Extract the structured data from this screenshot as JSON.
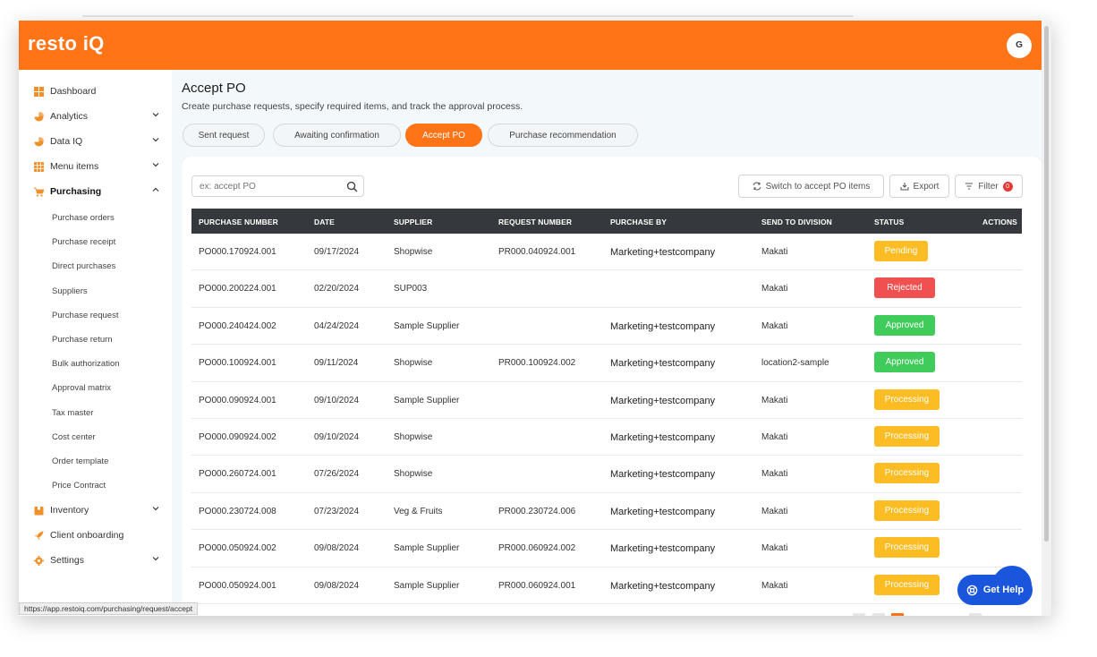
{
  "app": {
    "logo": "resto iQ",
    "avatar_initial": "G"
  },
  "sidebar": {
    "items": [
      {
        "label": "Dashboard",
        "icon": "dashboard-icon",
        "expandable": false
      },
      {
        "label": "Analytics",
        "icon": "pie-chart-icon",
        "expandable": true
      },
      {
        "label": "Data IQ",
        "icon": "pie-chart-icon",
        "expandable": true
      },
      {
        "label": "Menu items",
        "icon": "grid-icon",
        "expandable": true
      },
      {
        "label": "Purchasing",
        "icon": "cart-icon",
        "expandable": true,
        "expanded": true
      },
      {
        "label": "Inventory",
        "icon": "box-icon",
        "expandable": true
      },
      {
        "label": "Client onboarding",
        "icon": "rocket-icon",
        "expandable": false
      },
      {
        "label": "Settings",
        "icon": "gear-icon",
        "expandable": true
      }
    ],
    "purchasing_sub": [
      "Purchase orders",
      "Purchase receipt",
      "Direct purchases",
      "Suppliers",
      "Purchase request",
      "Purchase return",
      "Bulk authorization",
      "Approval matrix",
      "Tax master",
      "Cost center",
      "Order template",
      "Price Contract"
    ]
  },
  "page": {
    "title": "Accept PO",
    "subtitle": "Create purchase requests, specify required items, and track the approval process."
  },
  "tabs": [
    {
      "label": "Sent request",
      "active": false
    },
    {
      "label": "Awaiting confirmation",
      "active": false
    },
    {
      "label": "Accept PO",
      "active": true
    },
    {
      "label": "Purchase recommendation",
      "active": false
    }
  ],
  "toolbar": {
    "search_placeholder": "ex: accept PO",
    "switch_label": "Switch to accept PO items",
    "export_label": "Export",
    "filter_label": "Filter",
    "filter_count": "0"
  },
  "table": {
    "headers": [
      "PURCHASE NUMBER",
      "DATE",
      "SUPPLIER",
      "REQUEST NUMBER",
      "PURCHASE BY",
      "SEND TO DIVISION",
      "STATUS",
      "ACTIONS"
    ],
    "rows": [
      {
        "po": "PO000.170924.001",
        "date": "09/17/2024",
        "supplier": "Shopwise",
        "request": "PR000.040924.001",
        "by": "Marketing+testcompany",
        "division": "Makati",
        "status": "Pending"
      },
      {
        "po": "PO000.200224.001",
        "date": "02/20/2024",
        "supplier": "SUP003",
        "request": "",
        "by": "",
        "division": "Makati",
        "status": "Rejected"
      },
      {
        "po": "PO000.240424.002",
        "date": "04/24/2024",
        "supplier": "Sample Supplier",
        "request": "",
        "by": "Marketing+testcompany",
        "division": "Makati",
        "status": "Approved"
      },
      {
        "po": "PO000.100924.001",
        "date": "09/11/2024",
        "supplier": "Shopwise",
        "request": "PR000.100924.002",
        "by": "Marketing+testcompany",
        "division": "location2-sample",
        "status": "Approved"
      },
      {
        "po": "PO000.090924.001",
        "date": "09/10/2024",
        "supplier": "Sample Supplier",
        "request": "",
        "by": "Marketing+testcompany",
        "division": "Makati",
        "status": "Processing"
      },
      {
        "po": "PO000.090924.002",
        "date": "09/10/2024",
        "supplier": "Shopwise",
        "request": "",
        "by": "Marketing+testcompany",
        "division": "Makati",
        "status": "Processing"
      },
      {
        "po": "PO000.260724.001",
        "date": "07/26/2024",
        "supplier": "Shopwise",
        "request": "",
        "by": "Marketing+testcompany",
        "division": "Makati",
        "status": "Processing"
      },
      {
        "po": "PO000.230724.008",
        "date": "07/23/2024",
        "supplier": "Veg & Fruits",
        "request": "PR000.230724.006",
        "by": "Marketing+testcompany",
        "division": "Makati",
        "status": "Processing"
      },
      {
        "po": "PO000.050924.002",
        "date": "09/08/2024",
        "supplier": "Sample Supplier",
        "request": "PR000.060924.002",
        "by": "Marketing+testcompany",
        "division": "Makati",
        "status": "Processing"
      },
      {
        "po": "PO000.050924.001",
        "date": "09/08/2024",
        "supplier": "Sample Supplier",
        "request": "PR000.060924.001",
        "by": "Marketing+testcompany",
        "division": "Makati",
        "status": "Processing"
      }
    ]
  },
  "status_colors": {
    "Pending": "#fbbd23",
    "Rejected": "#f0504f",
    "Approved": "#3fcc5b",
    "Processing": "#fbbd23"
  },
  "brand_color": "#ff7417",
  "help": {
    "label": "Get Help"
  },
  "status_url": "https://app.restoiq.com/purchasing/request/accept"
}
